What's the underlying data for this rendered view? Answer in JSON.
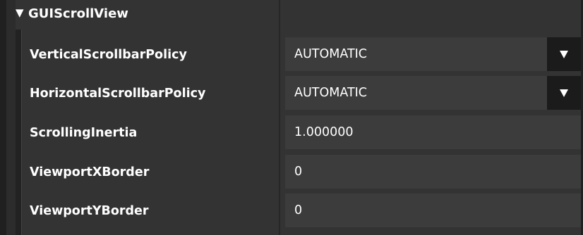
{
  "section": {
    "expander_glyph": "▼",
    "title": "GUIScrollView"
  },
  "properties": [
    {
      "label": "VerticalScrollbarPolicy",
      "value": "AUTOMATIC",
      "control": "dropdown"
    },
    {
      "label": "HorizontalScrollbarPolicy",
      "value": "AUTOMATIC",
      "control": "dropdown"
    },
    {
      "label": "ScrollingInertia",
      "value": "1.000000",
      "control": "text"
    },
    {
      "label": "ViewportXBorder",
      "value": "0",
      "control": "text"
    },
    {
      "label": "ViewportYBorder",
      "value": "0",
      "control": "text"
    }
  ],
  "colors": {
    "panel_bg": "#333333",
    "field_bg": "#3c3c3c",
    "dropdown_button_bg": "#1b1b1b",
    "text": "#ffffff"
  },
  "icons": {
    "expander": "caret-down-icon",
    "dropdown": "chevron-down-icon"
  }
}
